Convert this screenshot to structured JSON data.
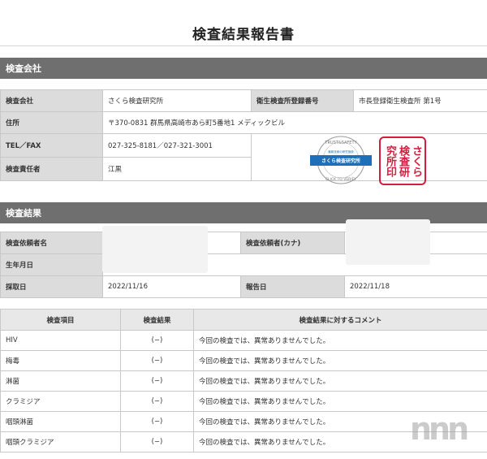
{
  "header": {
    "title": "検査結果報告書"
  },
  "company_section": {
    "heading": "検査会社",
    "company_label": "検査会社",
    "company_value": "さくら検査研究所",
    "registry_label": "衛生検査所登録番号",
    "registry_value": "市長登録衛生検査所 第1号",
    "address_label": "住所",
    "address_value": "〒370-0831 群馬県高崎市あら町5番地1 メディックビル",
    "tel_label": "TEL／FAX",
    "tel_value": "027-325-8181／027-321-3001",
    "manager_label": "検査責任者",
    "manager_value": "江黒",
    "logo_top": "TRUST&SAFETY",
    "logo_sub": "最新技術の研究施設",
    "logo_name": "さくら検査研究所",
    "logo_bottom": "CLICK TO VERIFY",
    "stamp_col1": "さくら",
    "stamp_col2": "検査研",
    "stamp_col3": "究所印"
  },
  "result_section": {
    "heading": "検査結果",
    "requester_label": "検査依頼者名",
    "requester_kana_label": "検査依頼者(カナ)",
    "birth_label": "生年月日",
    "sample_date_label": "採取日",
    "sample_date_value": "2022/11/16",
    "report_date_label": "報告日",
    "report_date_value": "2022/11/18"
  },
  "results_table": {
    "headers": [
      "検査項目",
      "検査結果",
      "検査結果に対するコメント"
    ],
    "rows": [
      {
        "item": "HIV",
        "result": "(−)",
        "comment": "今回の検査では、異常ありませんでした。"
      },
      {
        "item": "梅毒",
        "result": "(−)",
        "comment": "今回の検査では、異常ありませんでした。"
      },
      {
        "item": "淋菌",
        "result": "(−)",
        "comment": "今回の検査では、異常ありませんでした。"
      },
      {
        "item": "クラミジア",
        "result": "(−)",
        "comment": "今回の検査では、異常ありませんでした。"
      },
      {
        "item": "咽頭淋菌",
        "result": "(−)",
        "comment": "今回の検査では、異常ありませんでした。"
      },
      {
        "item": "咽頭クラミジア",
        "result": "(−)",
        "comment": "今回の検査では、異常ありませんでした。"
      }
    ]
  },
  "watermark": "nnn",
  "colors": {
    "section_bg": "#6f6f6f",
    "label_bg": "#dcdcdc",
    "stamp_red": "#d41d3e",
    "logo_blue": "#1c6fb8"
  }
}
